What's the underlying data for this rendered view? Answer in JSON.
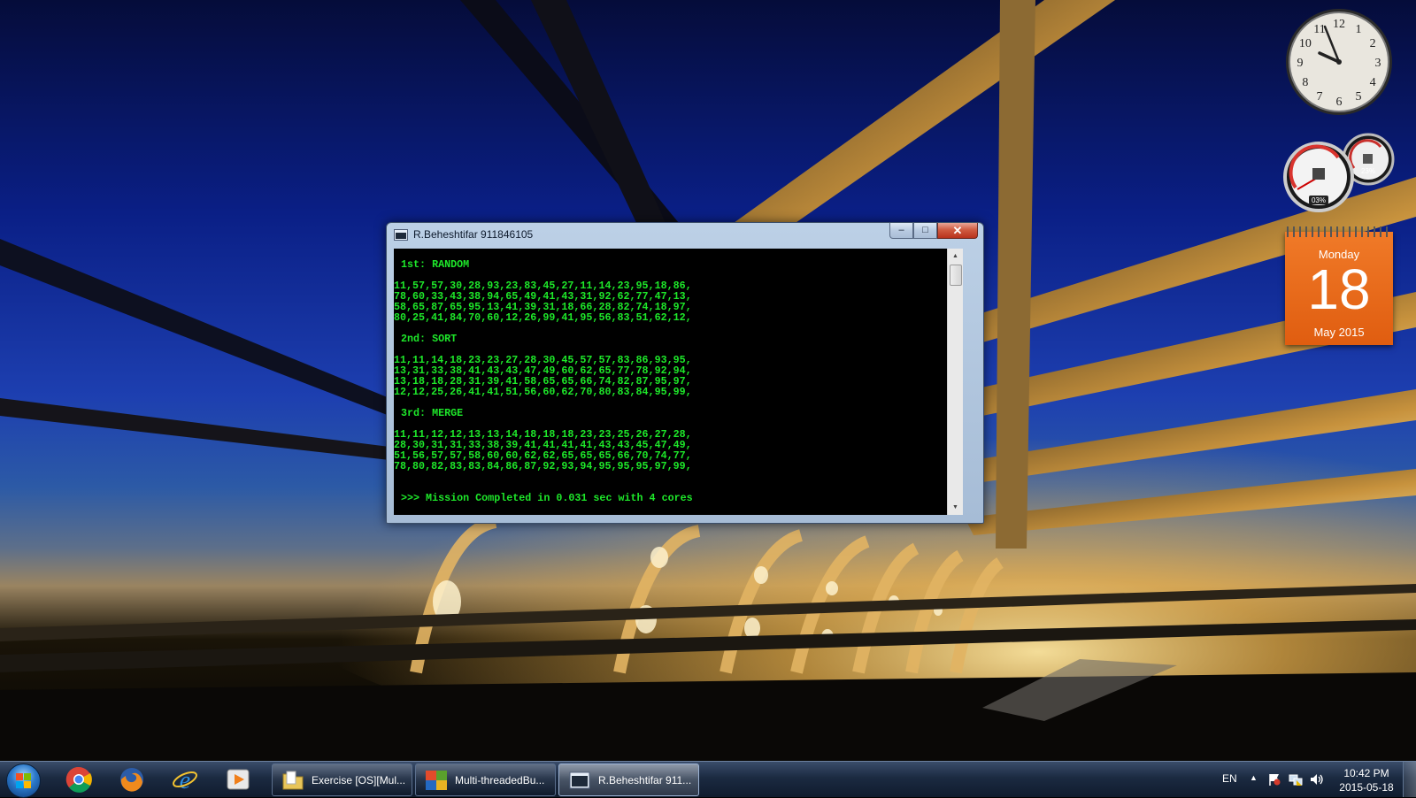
{
  "window": {
    "title": "R.Beheshtifar 911846105",
    "buttons": {
      "minimize": "–",
      "maximize": "□",
      "close": "✕"
    },
    "icon": "console-icon"
  },
  "console": {
    "random_header": "1st: RANDOM",
    "random_lines": [
      "11,57,57,30,28,93,23,83,45,27,11,14,23,95,18,86,",
      "78,60,33,43,38,94,65,49,41,43,31,92,62,77,47,13,",
      "58,65,87,65,95,13,41,39,31,18,66,28,82,74,18,97,",
      "80,25,41,84,70,60,12,26,99,41,95,56,83,51,62,12,"
    ],
    "sort_header": "2nd: SORT",
    "sort_lines": [
      "11,11,14,18,23,23,27,28,30,45,57,57,83,86,93,95,",
      "13,31,33,38,41,43,43,47,49,60,62,65,77,78,92,94,",
      "13,18,18,28,31,39,41,58,65,65,66,74,82,87,95,97,",
      "12,12,25,26,41,41,51,56,60,62,70,80,83,84,95,99,"
    ],
    "merge_header": "3rd: MERGE",
    "merge_lines": [
      "11,11,12,12,13,13,14,18,18,18,23,23,25,26,27,28,",
      "28,30,31,31,33,38,39,41,41,41,41,43,43,45,47,49,",
      "51,56,57,57,58,60,60,62,62,65,65,65,66,70,74,77,",
      "78,80,82,83,83,84,86,87,92,93,94,95,95,95,97,99,"
    ],
    "completion": ">>> Mission Completed in 0.031 sec with 4 cores",
    "text_color": "#1ee82a"
  },
  "gadgets": {
    "clock": {
      "numerals": [
        "12",
        "1",
        "2",
        "3",
        "4",
        "5",
        "6",
        "7",
        "8",
        "9",
        "10",
        "11"
      ],
      "time": "10:42"
    },
    "meters": {
      "cpu": "03%",
      "memory": "23%"
    },
    "calendar": {
      "weekday": "Monday",
      "day": "18",
      "month_year": "May 2015",
      "color": "#e8661a"
    }
  },
  "taskbar": {
    "start": "windows-start-icon",
    "pinned": [
      "chrome-icon",
      "firefox-icon",
      "internet-explorer-icon",
      "media-player-icon"
    ],
    "tasks": [
      {
        "label": "Exercise [OS][Mul...",
        "icon": "folder-icon",
        "active": false
      },
      {
        "label": "Multi-threadedBu...",
        "icon": "visual-studio-icon",
        "active": false
      },
      {
        "label": "R.Beheshtifar 911...",
        "icon": "console-icon",
        "active": true
      }
    ],
    "tray": {
      "language": "EN",
      "time": "10:42 PM",
      "date": "2015-05-18",
      "icons": [
        "show-hidden-icons-arrow",
        "action-center-flag-icon",
        "network-icon",
        "volume-icon"
      ]
    }
  }
}
